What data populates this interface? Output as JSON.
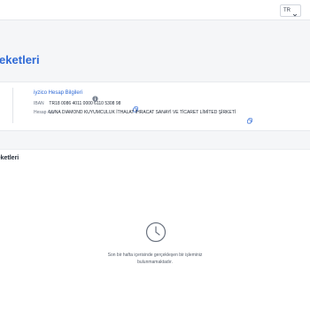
{
  "header": {
    "language": "TR"
  },
  "page": {
    "title": "reketleri"
  },
  "account": {
    "title": "iyzico Hesap Bilgileri",
    "iban_label": "IBAN",
    "iban_value": "TR18 0086 4011 0000 6110 5308 98",
    "holder_label": "Hesap Adı",
    "holder_value": "LUNA DIAMOND KUYUMCULUK İTHALAT İHRACAT SANAYİ VE TİCARET LİMİTED ŞİRKETİ"
  },
  "transactions": {
    "title": "reketleri",
    "empty_message": "Son bir hafta içerisinde gerçekleşen bir işleminiz bulunmamaktadır."
  },
  "colors": {
    "accent": "#2f6ad6",
    "background": "#f5f6f8",
    "panel": "#ffffff"
  },
  "icons": [
    "chevron-down-icon",
    "info-icon",
    "copy-icon",
    "clock-icon"
  ]
}
